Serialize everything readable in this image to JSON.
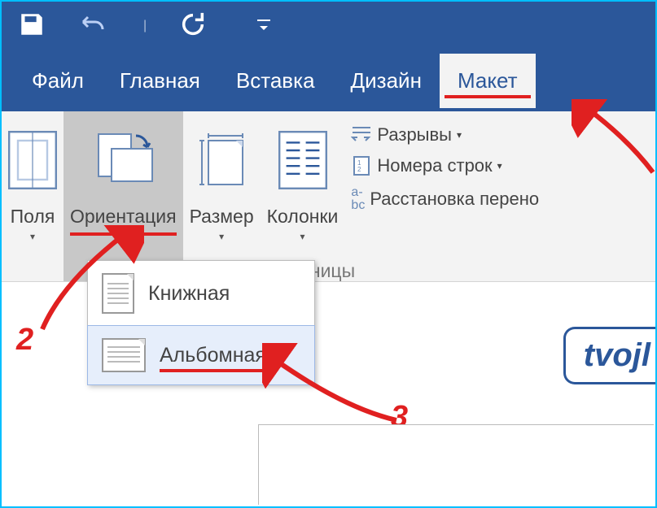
{
  "qat": {
    "save": "save",
    "undo": "undo",
    "redo": "redo",
    "customize": "customize"
  },
  "tabs": {
    "file": "Файл",
    "home": "Главная",
    "insert": "Вставка",
    "design": "Дизайн",
    "layout": "Макет"
  },
  "ribbon": {
    "margins": "Поля",
    "orientation": "Ориентация",
    "size": "Размер",
    "columns": "Колонки",
    "breaks": "Разрывы",
    "line_numbers": "Номера строк",
    "hyphenation": "Расстановка перено",
    "group_name_suffix": "тры страницы"
  },
  "dropdown": {
    "portrait": "Книжная",
    "landscape": "Альбомная"
  },
  "annotations": {
    "n2": "2",
    "n3": "3"
  },
  "watermark": "tvojl"
}
